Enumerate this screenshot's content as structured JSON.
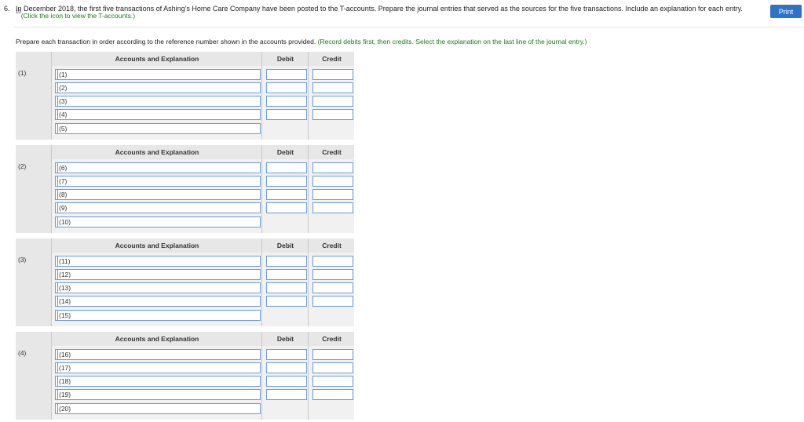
{
  "question": {
    "number": "6.",
    "text": "In December 2018, the first five transactions of Ashing's Home Care Company have been posted to the T-accounts. Prepare the journal entries that served as the sources for the five transactions. Include an explanation for each entry.",
    "sup": "10",
    "link_text": "(Click the icon to view the T-accounts.)",
    "print_label": "Print"
  },
  "instructions": {
    "text": "Prepare each transaction in order according to the reference number shown in the accounts provided.",
    "hint": "(Record debits first, then credits. Select the explanation on the last line of the journal entry.)"
  },
  "table_headers": {
    "accounts": "Accounts and Explanation",
    "debit": "Debit",
    "credit": "Credit"
  },
  "journals": [
    {
      "ref": "(1)",
      "rows": [
        "(1)",
        "(2)",
        "(3)",
        "(4)",
        "(5)"
      ]
    },
    {
      "ref": "(2)",
      "rows": [
        "(6)",
        "(7)",
        "(8)",
        "(9)",
        "(10)"
      ]
    },
    {
      "ref": "(3)",
      "rows": [
        "(11)",
        "(12)",
        "(13)",
        "(14)",
        "(15)"
      ]
    },
    {
      "ref": "(4)",
      "rows": [
        "(16)",
        "(17)",
        "(18)",
        "(19)",
        "(20)"
      ]
    }
  ],
  "colors": {
    "accent_button": "#2d73c8",
    "hint_green": "#1a7a1a",
    "input_border": "#6a9cd2",
    "header_bg": "#e7e7e7"
  }
}
